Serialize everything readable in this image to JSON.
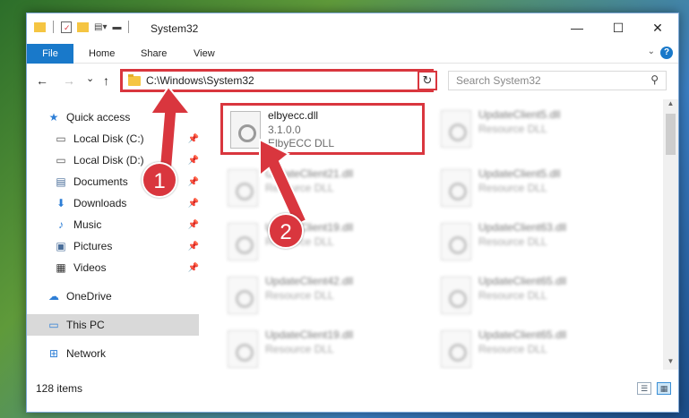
{
  "window": {
    "title": "System32",
    "controls": {
      "minimize": "—",
      "maximize": "☐",
      "close": "✕"
    }
  },
  "ribbon": {
    "file": "File",
    "tabs": [
      "Home",
      "Share",
      "View"
    ],
    "help": "?"
  },
  "nav": {
    "back": "←",
    "forward": "→",
    "recent": "⌄",
    "up": "↑",
    "address": "C:\\Windows\\System32",
    "refresh": "↻",
    "search_placeholder": "Search System32"
  },
  "sidebar": {
    "items": [
      {
        "label": "Quick access",
        "icon": "star-icon",
        "glyph": "★",
        "pinned": false
      },
      {
        "label": "Local Disk (C:)",
        "icon": "drive-icon",
        "glyph": "▭",
        "pinned": true
      },
      {
        "label": "Local Disk (D:)",
        "icon": "drive-icon",
        "glyph": "▭",
        "pinned": true
      },
      {
        "label": "Documents",
        "icon": "document-icon",
        "glyph": "▤",
        "pinned": true
      },
      {
        "label": "Downloads",
        "icon": "download-icon",
        "glyph": "⬇",
        "pinned": true
      },
      {
        "label": "Music",
        "icon": "music-icon",
        "glyph": "♪",
        "pinned": true
      },
      {
        "label": "Pictures",
        "icon": "picture-icon",
        "glyph": "▣",
        "pinned": true
      },
      {
        "label": "Videos",
        "icon": "video-icon",
        "glyph": "▦",
        "pinned": true
      },
      {
        "label": "OneDrive",
        "icon": "cloud-icon",
        "glyph": "☁",
        "pinned": false
      },
      {
        "label": "This PC",
        "icon": "computer-icon",
        "glyph": "▭",
        "pinned": false
      },
      {
        "label": "Network",
        "icon": "network-icon",
        "glyph": "⊞",
        "pinned": false
      }
    ],
    "pin_glyph": "📌"
  },
  "files": [
    {
      "name": "elbyecc.dll",
      "line1": "3.1.0.0",
      "line2": "ElbyECC DLL"
    },
    {
      "name": "UpdateClient5.dll",
      "line1": "Resource DLL",
      "line2": ""
    },
    {
      "name": "UpdateClient21.dll",
      "line1": "Resource DLL",
      "line2": ""
    },
    {
      "name": "UpdateClient5.dll",
      "line1": "Resource DLL",
      "line2": ""
    },
    {
      "name": "UpdateClient19.dll",
      "line1": "Resource DLL",
      "line2": ""
    },
    {
      "name": "UpdateClient63.dll",
      "line1": "Resource DLL",
      "line2": ""
    },
    {
      "name": "UpdateClient42.dll",
      "line1": "Resource DLL",
      "line2": ""
    },
    {
      "name": "UpdateClient65.dll",
      "line1": "Resource DLL",
      "line2": ""
    },
    {
      "name": "UpdateClient19.dll",
      "line1": "Resource DLL",
      "line2": ""
    },
    {
      "name": "UpdateClient65.dll",
      "line1": "Resource DLL",
      "line2": ""
    }
  ],
  "status": {
    "count": "128 items"
  },
  "annotations": {
    "step1": "1",
    "step2": "2"
  },
  "colors": {
    "accent": "#1979ca",
    "highlight": "#d9363e"
  }
}
